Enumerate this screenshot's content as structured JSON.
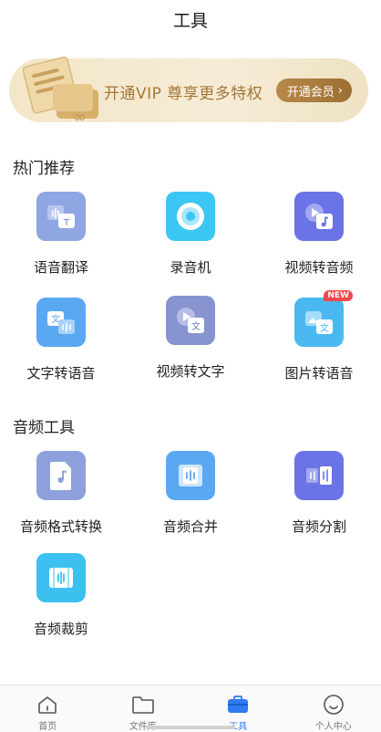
{
  "header": {
    "title": "工具"
  },
  "banner": {
    "text": "开通VIP 尊享更多特权",
    "button_label": "开通会员",
    "button_icon": "chevron-right-icon",
    "accent": "#a4773a"
  },
  "sections": [
    {
      "title": "热门推荐",
      "items": [
        {
          "label": "语音翻译",
          "icon": "voice-translate-icon",
          "color": "#8fa6e2"
        },
        {
          "label": "录音机",
          "icon": "recorder-icon",
          "color": "#3cc6f4"
        },
        {
          "label": "视频转音频",
          "icon": "video-to-audio-icon",
          "color": "#6b74e6"
        },
        {
          "label": "文字转语音",
          "icon": "text-to-speech-icon",
          "color": "#5aa8f2"
        },
        {
          "label": "视频转文字",
          "icon": "video-to-text-icon",
          "color": "#8894cf"
        },
        {
          "label": "图片转语音",
          "icon": "image-to-speech-icon",
          "color": "#4ab9f2",
          "badge": "NEW"
        }
      ]
    },
    {
      "title": "音频工具",
      "items": [
        {
          "label": "音频格式转换",
          "icon": "audio-format-icon",
          "color": "#8fa1dc"
        },
        {
          "label": "音频合并",
          "icon": "audio-merge-icon",
          "color": "#5aa8f2"
        },
        {
          "label": "音频分割",
          "icon": "audio-split-icon",
          "color": "#6b74e6"
        },
        {
          "label": "音频裁剪",
          "icon": "audio-trim-icon",
          "color": "#3cc0f0"
        }
      ]
    }
  ],
  "tabbar": [
    {
      "label": "首页",
      "icon": "home-icon",
      "active": false
    },
    {
      "label": "文件库",
      "icon": "folder-icon",
      "active": false
    },
    {
      "label": "工具",
      "icon": "toolbox-icon",
      "active": true,
      "color": "#2f7bf4"
    },
    {
      "label": "个人中心",
      "icon": "smiley-icon",
      "active": false
    }
  ]
}
